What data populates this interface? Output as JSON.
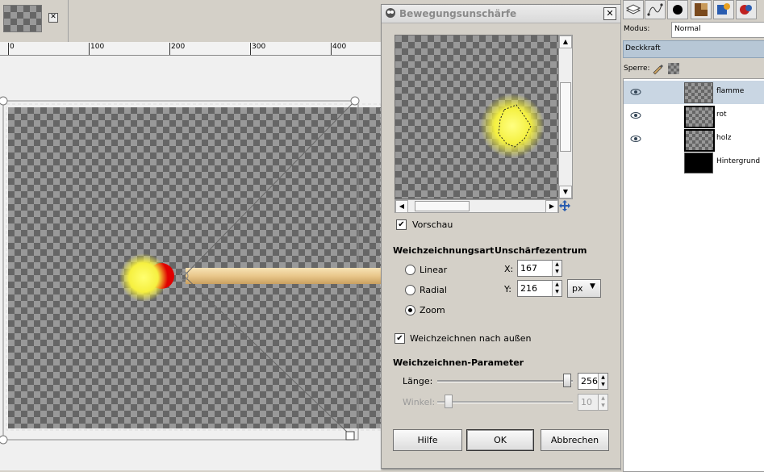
{
  "dialog": {
    "title": "Bewegungsunschärfe",
    "close_glyph": "✕",
    "preview_checkbox": {
      "label": "Vorschau",
      "checked": true
    },
    "blur_type": {
      "heading": "Weichzeichnungsart",
      "options": [
        {
          "label": "Linear",
          "selected": false
        },
        {
          "label": "Radial",
          "selected": false
        },
        {
          "label": "Zoom",
          "selected": true
        }
      ]
    },
    "blur_center": {
      "heading": "Unschärfezentrum",
      "x_label": "X:",
      "x_value": "167",
      "y_label": "Y:",
      "y_value": "216",
      "unit": "px"
    },
    "outward_checkbox": {
      "label": "Weichzeichnen nach außen",
      "checked": true
    },
    "params": {
      "heading": "Weichzeichnen-Parameter",
      "length_label": "Länge:",
      "length_value": "256",
      "length_max": 256,
      "angle_label": "Winkel:",
      "angle_value": "10",
      "angle_max": 180
    },
    "buttons": {
      "help": "Hilfe",
      "ok": "OK",
      "cancel": "Abbrechen"
    }
  },
  "ruler": {
    "labels": [
      "0",
      "100",
      "200",
      "300",
      "400"
    ]
  },
  "tab": {
    "close_glyph": "✕"
  },
  "dock": {
    "mode_label": "Modus:",
    "mode_value": "Normal",
    "opacity_label": "Deckkraft",
    "lock_label": "Sperre:",
    "layers": [
      {
        "name": "flamme",
        "selected": true,
        "visible": true,
        "thumb": "checker-yellow"
      },
      {
        "name": "rot",
        "selected": false,
        "visible": true,
        "thumb": "checker"
      },
      {
        "name": "holz",
        "selected": false,
        "visible": true,
        "thumb": "checker-wood"
      },
      {
        "name": "Hintergrund",
        "selected": false,
        "visible": false,
        "thumb": "black"
      }
    ]
  },
  "colors": {
    "selection_bar": "#b7c7d6",
    "glow": "#ffff66",
    "match_head": "#e00000",
    "wood": "#f0d8a8"
  }
}
